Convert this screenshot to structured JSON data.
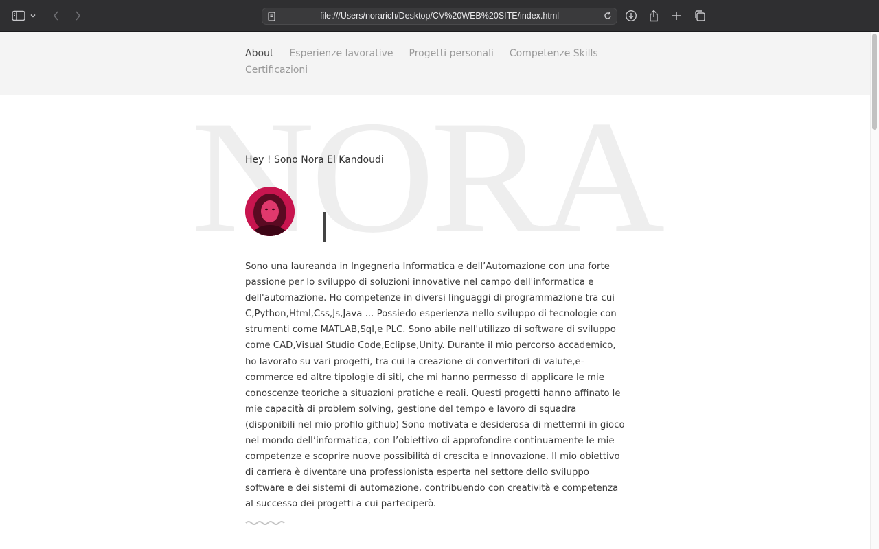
{
  "browser": {
    "url": "file:///Users/norarich/Desktop/CV%20WEB%20SITE/index.html"
  },
  "nav": {
    "items": [
      {
        "label": "About",
        "active": true
      },
      {
        "label": "Esperienze lavorative",
        "active": false
      },
      {
        "label": "Progetti personali",
        "active": false
      },
      {
        "label": "Competenze Skills",
        "active": false
      },
      {
        "label": "Certificazioni",
        "active": false
      }
    ]
  },
  "hero": {
    "background_name": "NORA",
    "greeting": "Hey ! Sono Nora El Kandoudi",
    "avatar_color": "#c4164f"
  },
  "about": {
    "bio": "Sono una laureanda in Ingegneria Informatica e dell’Automazione con una forte passione per lo sviluppo di soluzioni innovative nel campo dell'informatica e dell'automazione. Ho competenze in diversi linguaggi di programmazione tra cui C,Python,Html,Css,Js,Java ... Possiedo esperienza nello sviluppo di tecnologie con strumenti come MATLAB,Sql,e PLC. Sono abile nell'utilizzo di software di sviluppo come CAD,Visual Studio Code,Eclipse,Unity. Durante il mio percorso accademico, ho lavorato su vari progetti, tra cui la creazione di convertitori di valute,e-commerce ed altre tipologie di siti, che mi hanno permesso di applicare le mie conoscenze teoriche a situazioni pratiche e reali. Questi progetti hanno affinato le mie capacità di problem solving, gestione del tempo e lavoro di squadra (disponibili nel mio profilo github) Sono motivata e desiderosa di mettermi in gioco nel mondo dell’informatica, con l’obiettivo di approfondire continuamente le mie competenze e scoprire nuove possibilità di crescita e innovazione. Il mio obiettivo di carriera è diventare una professionista esperta nel settore dello sviluppo software e dei sistemi di automazione, contribuendo con creatività e competenza al successo dei progetti a cui parteciperò."
  }
}
